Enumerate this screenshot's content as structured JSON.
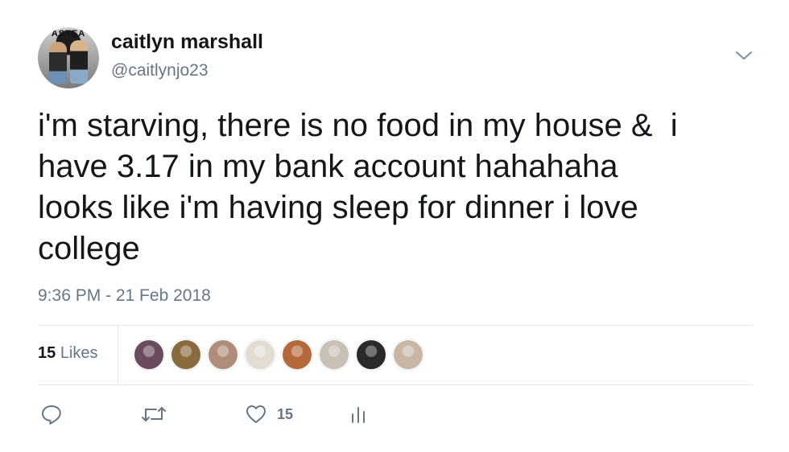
{
  "tweet": {
    "display_name": "caitlyn marshall",
    "handle": "@caitlynjo23",
    "avatar_sign_text": "ASTEA",
    "text": "i'm starving, there is no food in my house &  i\nhave 3.17 in my bank account hahahaha\nlooks like i'm having sleep for dinner i love\ncollege",
    "timestamp": "9:36 PM - 21 Feb 2018"
  },
  "stats": {
    "likes_number": "15",
    "likes_label": "Likes",
    "likers": [
      {
        "name": "liker-1",
        "color": "#6b4b5e"
      },
      {
        "name": "liker-2",
        "color": "#8a6a3f"
      },
      {
        "name": "liker-3",
        "color": "#b08d7a"
      },
      {
        "name": "liker-4",
        "color": "#e3dcd3"
      },
      {
        "name": "liker-5",
        "color": "#b5693a"
      },
      {
        "name": "liker-6",
        "color": "#c9c0b5"
      },
      {
        "name": "liker-7",
        "color": "#2a2a2a"
      },
      {
        "name": "liker-8",
        "color": "#c7b7a4"
      }
    ]
  },
  "actions": {
    "reply_icon": "reply-icon",
    "retweet_icon": "retweet-icon",
    "like_icon": "heart-icon",
    "like_count": "15",
    "analytics_icon": "analytics-icon"
  },
  "colors": {
    "text": "#14171a",
    "secondary": "#657786",
    "divider": "#e1e8ed",
    "icon": "#657786"
  }
}
